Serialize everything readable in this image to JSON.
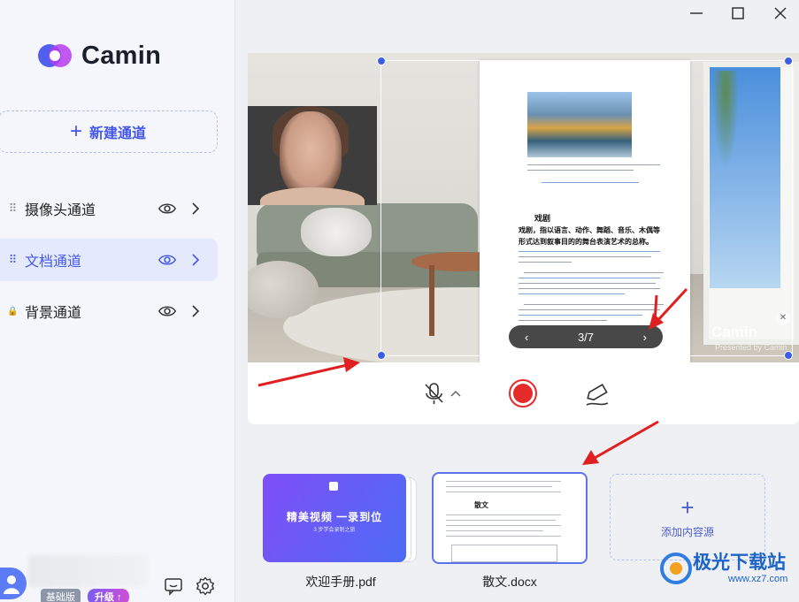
{
  "app": {
    "name": "Camin"
  },
  "sidebar": {
    "new_channel_label": "新建通道",
    "channels": [
      {
        "label": "摄像头通道",
        "lead": "⠿",
        "active": false
      },
      {
        "label": "文档通道",
        "lead": "⠿",
        "active": true
      },
      {
        "label": "背景通道",
        "lead": "🔒",
        "active": false
      }
    ],
    "footer": {
      "plan_badge": "基础版",
      "upgrade_badge": "升级 ↑"
    }
  },
  "preview": {
    "page_indicator": "3/7",
    "prev_symbol": "‹",
    "next_symbol": "›",
    "watermark": "Camin",
    "watermark_sub": "Presented by Camin",
    "document": {
      "heading": "戏剧",
      "bold_text": "戏剧，指以语言、动作、舞蹈、音乐、木偶等形式达到叙事目的的舞台表演艺术的总称。"
    }
  },
  "tray": {
    "items": [
      {
        "caption": "欢迎手册.pdf",
        "card_title": "精美视频  一录到位",
        "card_subtitle": "3 步学会录制之旅"
      },
      {
        "caption": "散文.docx",
        "card_title": "散文"
      }
    ],
    "add_label": "添加内容源"
  },
  "site_watermark": {
    "text": "极光下载站",
    "url": "www.xz7.com"
  },
  "colors": {
    "accent": "#4457e8",
    "record": "#e52a2a",
    "arrow": "#e02020"
  }
}
